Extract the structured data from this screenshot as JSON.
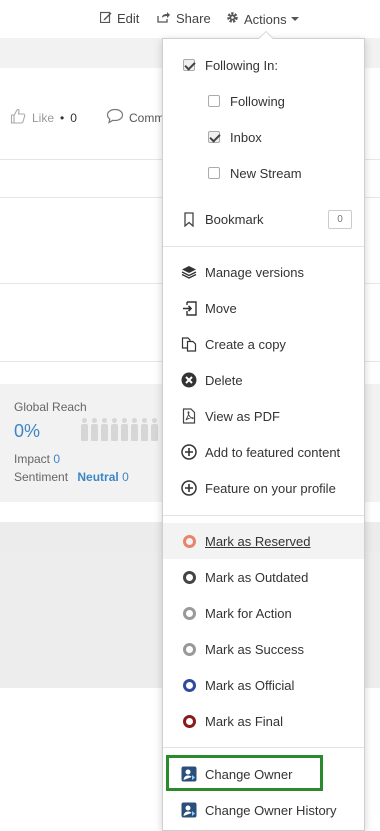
{
  "toolbar": {
    "edit_label": "Edit",
    "share_label": "Share",
    "actions_label": "Actions"
  },
  "background": {
    "like_label": "Like",
    "like_separator": "•",
    "like_count": "0",
    "comment_label": "Comm",
    "global_reach_label": "Global Reach",
    "global_reach_value": "0%",
    "impact_label": "Impact",
    "impact_value": "0",
    "sentiment_label": "Sentiment",
    "sentiment_value": "Neutral",
    "sentiment_count": "0"
  },
  "menu": {
    "following_in": {
      "label": "Following In:",
      "checked": true
    },
    "following": {
      "label": "Following",
      "checked": false
    },
    "inbox": {
      "label": "Inbox",
      "checked": true
    },
    "new_stream": {
      "label": "New Stream",
      "checked": false
    },
    "bookmark": {
      "label": "Bookmark",
      "count": "0"
    },
    "manage_versions": "Manage versions",
    "move": "Move",
    "create_copy": "Create a copy",
    "delete": "Delete",
    "view_pdf": "View as PDF",
    "add_featured": "Add to featured content",
    "feature_profile": "Feature on your profile",
    "mark_reserved": {
      "label": "Mark as Reserved",
      "color": "#e8846b"
    },
    "mark_outdated": {
      "label": "Mark as Outdated",
      "color": "#444444"
    },
    "mark_action": {
      "label": "Mark for Action",
      "color": "#999999"
    },
    "mark_success": {
      "label": "Mark as Success",
      "color": "#999999"
    },
    "mark_official": {
      "label": "Mark as Official",
      "color": "#2f4a9e"
    },
    "mark_final": {
      "label": "Mark as Final",
      "color": "#8b1a1a"
    },
    "change_owner": "Change Owner",
    "change_owner_history": "Change Owner History"
  },
  "highlight_color": "#2b8a2b"
}
